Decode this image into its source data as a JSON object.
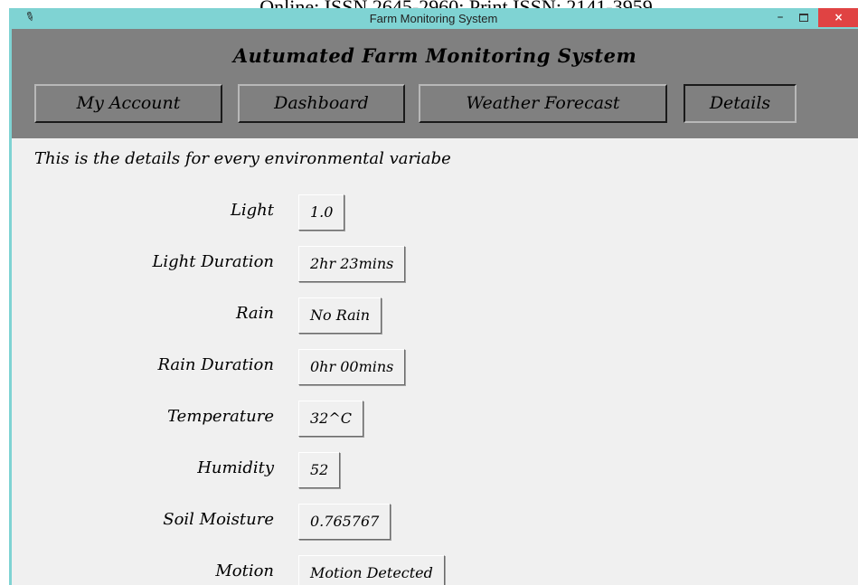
{
  "journal_header": "Online: ISSN 2645-2960; Print ISSN: 2141-3959",
  "window": {
    "title": "Farm Monitoring System",
    "icon": "feather-icon",
    "controls": {
      "minimize": "–",
      "close": "×"
    }
  },
  "app": {
    "title": "Autumated Farm Monitoring System",
    "nav": [
      "My Account",
      "Dashboard",
      "Weather Forecast",
      "Details"
    ],
    "active_tab": "Details"
  },
  "details": {
    "description": "This is the details for every environmental variabe",
    "rows": [
      {
        "label": "Light",
        "value": "1.0"
      },
      {
        "label": "Light Duration",
        "value": "2hr 23mins"
      },
      {
        "label": "Rain",
        "value": "No Rain"
      },
      {
        "label": "Rain Duration",
        "value": "0hr 00mins"
      },
      {
        "label": "Temperature",
        "value": "32^C"
      },
      {
        "label": "Humidity",
        "value": "52"
      },
      {
        "label": "Soil Moisture",
        "value": "0.765767"
      },
      {
        "label": "Motion",
        "value": "Motion Detected"
      }
    ]
  },
  "colors": {
    "titlebar": "#7fd3d3",
    "header_band": "#808080",
    "client_bg": "#f0f0f0",
    "close_button": "#e04343"
  }
}
